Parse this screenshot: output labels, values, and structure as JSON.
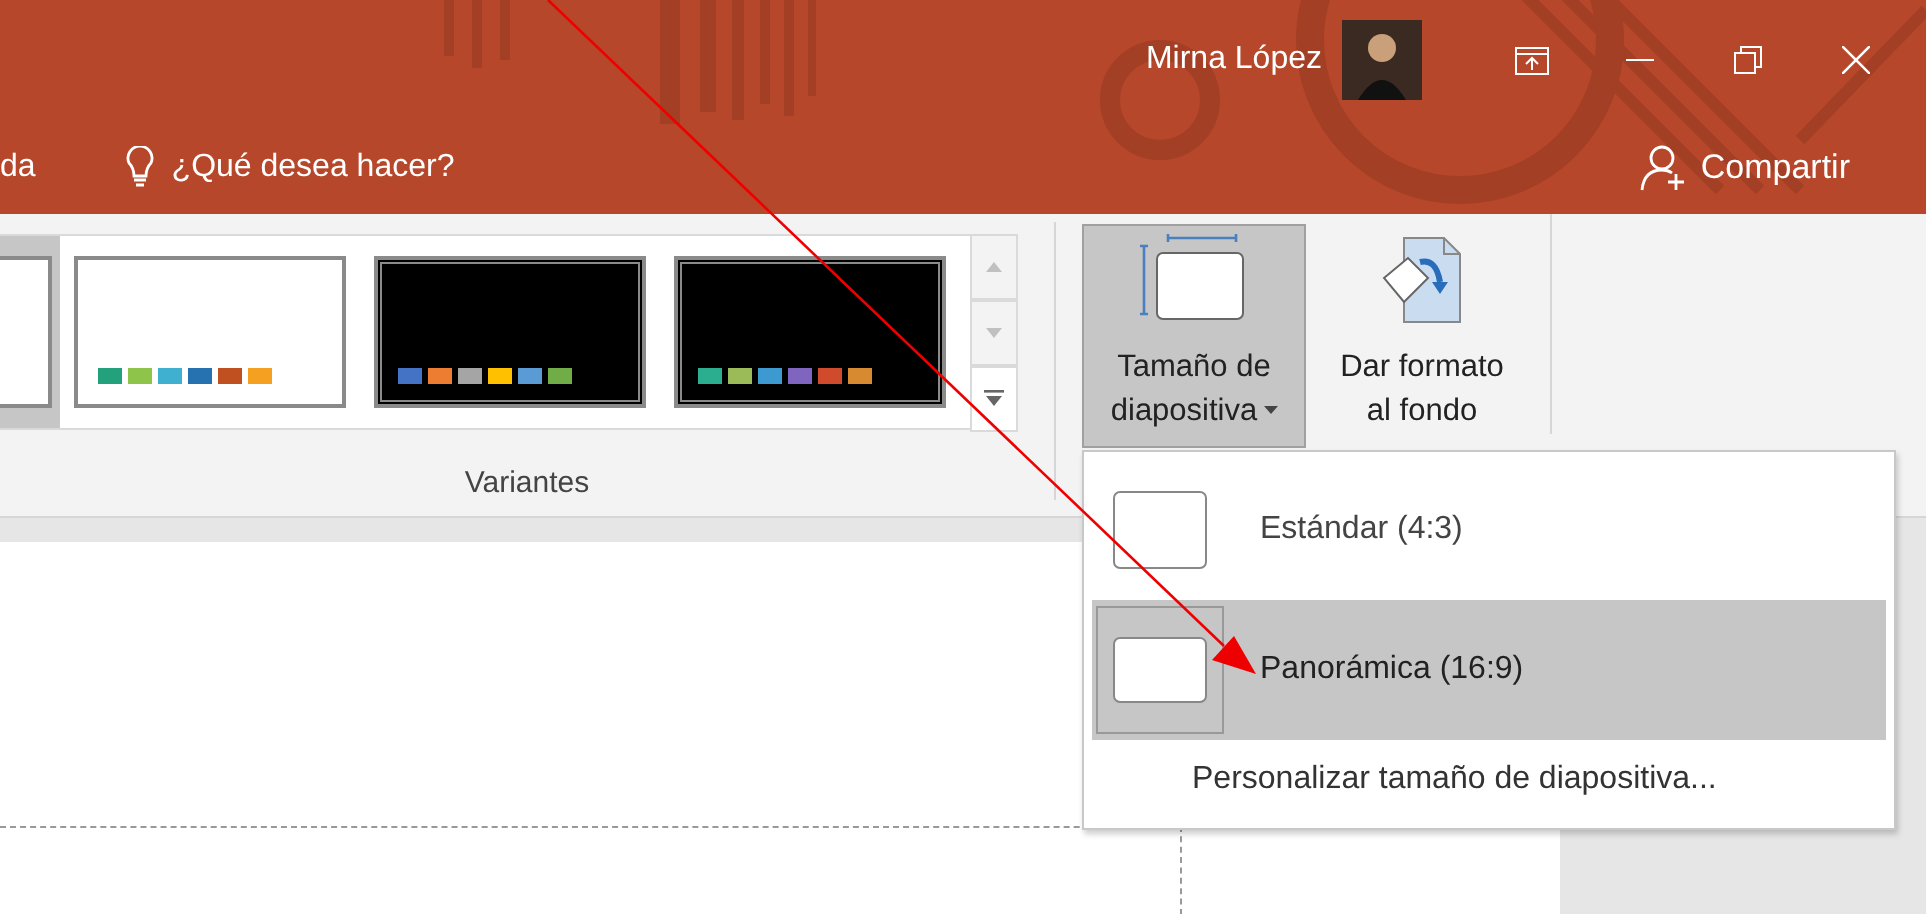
{
  "title_bar": {
    "user_name": "Mirna López"
  },
  "tell_me": {
    "tab_fragment": "da",
    "placeholder": "¿Qué desea hacer?",
    "share": "Compartir"
  },
  "variants": {
    "label": "Variantes",
    "items": [
      {
        "kind": "light",
        "selected": true
      },
      {
        "kind": "light",
        "selected": false,
        "swatches": [
          {
            "color": "#23a07c"
          },
          {
            "color": "#8dc449"
          },
          {
            "color": "#3fb0d0"
          },
          {
            "color": "#2672b0"
          },
          {
            "color": "#c0501f"
          },
          {
            "color": "#f5a020"
          }
        ]
      },
      {
        "kind": "dark",
        "selected": false,
        "swatches": [
          {
            "color": "#4472c4"
          },
          {
            "color": "#ed7d31"
          },
          {
            "color": "#a5a5a5"
          },
          {
            "color": "#ffc000"
          },
          {
            "color": "#5b9bd5"
          },
          {
            "color": "#70ad47"
          }
        ]
      },
      {
        "kind": "dark",
        "selected": false,
        "swatches": [
          {
            "color": "#2bae8f"
          },
          {
            "color": "#9bbb59"
          },
          {
            "color": "#3c9ad0"
          },
          {
            "color": "#8065c0"
          },
          {
            "color": "#d04a2c"
          },
          {
            "color": "#d88a30"
          }
        ]
      }
    ]
  },
  "commands": [
    {
      "lines": [
        "Tamaño de",
        "diapositiva"
      ],
      "kind": "slide-size",
      "pressed": true,
      "dropdown": true
    },
    {
      "lines": [
        "Dar formato",
        "al fondo"
      ],
      "kind": "background",
      "pressed": false,
      "dropdown": false
    }
  ],
  "menu": {
    "items": [
      {
        "label": "Estándar (4:3)",
        "kind": "size",
        "selected": false
      },
      {
        "label": "Panorámica (16:9)",
        "kind": "size",
        "selected": true
      },
      {
        "label": "Personalizar tamaño de diapositiva...",
        "kind": "link"
      }
    ]
  }
}
